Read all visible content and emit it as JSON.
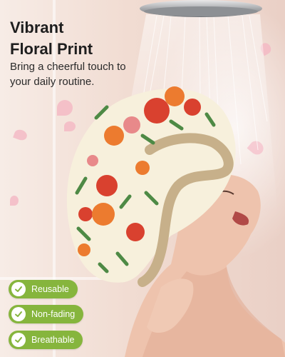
{
  "headline": {
    "line1": "Vibrant",
    "line2": "Floral Print"
  },
  "subtitle": {
    "line1": "Bring a cheerful touch to",
    "line2": "your daily routine."
  },
  "badges": [
    {
      "label": "Reusable",
      "icon": "check-icon"
    },
    {
      "label": "Non-fading",
      "icon": "check-icon"
    },
    {
      "label": "Breathable",
      "icon": "check-icon"
    }
  ],
  "colors": {
    "badge_bg": "#86b53d",
    "headline_text": "#1e1e1e",
    "cap_base": "#f7f0dc",
    "cap_flower_red": "#d9412f",
    "cap_flower_orange": "#ec7b2f",
    "cap_leaf_green": "#4e8a45",
    "cap_ruffle": "#c7b08a"
  }
}
